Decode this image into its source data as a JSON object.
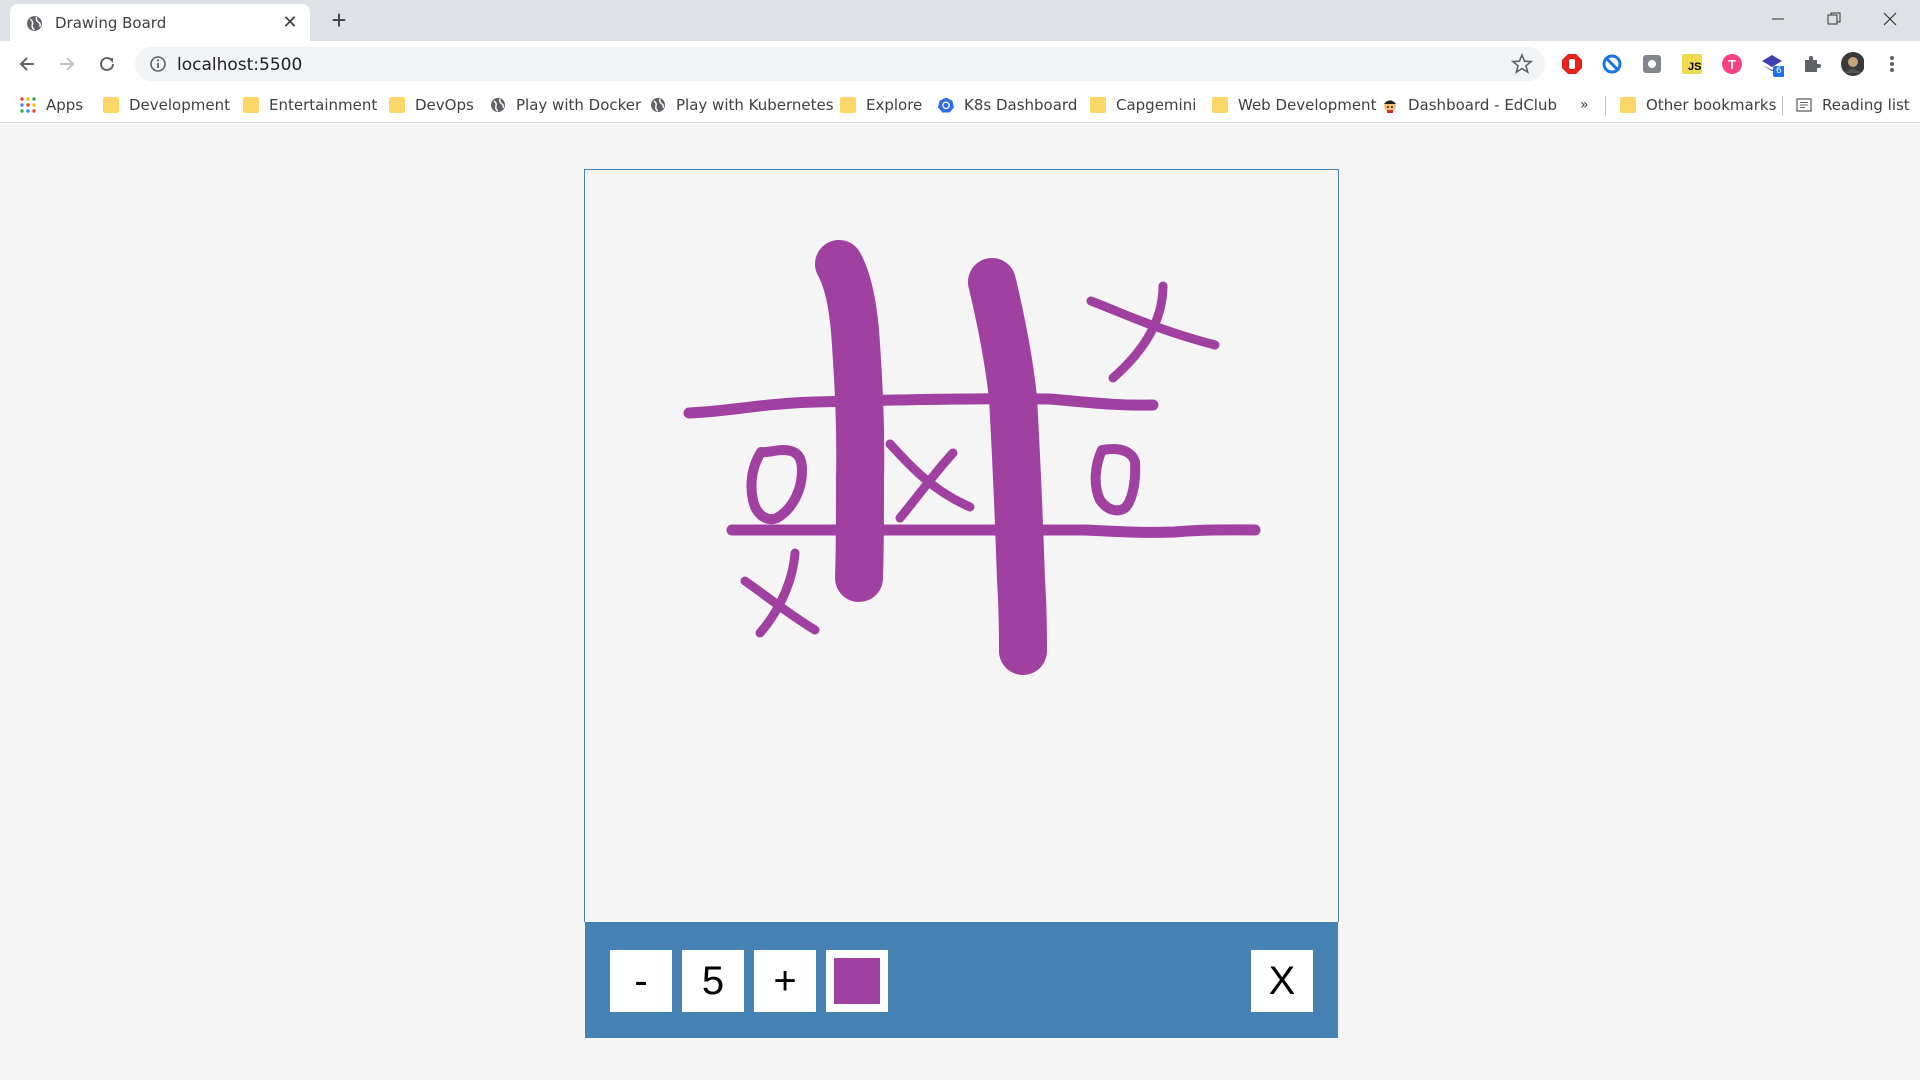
{
  "browser": {
    "tab_title": "Drawing Board",
    "url": "localhost:5500",
    "bookmarks": [
      {
        "label": "Apps",
        "icon": "apps-grid-icon"
      },
      {
        "label": "Development",
        "icon": "folder-icon"
      },
      {
        "label": "Entertainment",
        "icon": "folder-icon"
      },
      {
        "label": "DevOps",
        "icon": "folder-icon"
      },
      {
        "label": "Play with Docker",
        "icon": "globe-icon"
      },
      {
        "label": "Play with Kubernetes",
        "icon": "globe-icon"
      },
      {
        "label": "Explore",
        "icon": "folder-icon"
      },
      {
        "label": "K8s Dashboard",
        "icon": "kubernetes-icon"
      },
      {
        "label": "Capgemini",
        "icon": "folder-icon"
      },
      {
        "label": "Web Development",
        "icon": "folder-icon"
      },
      {
        "label": "Dashboard - EdClub",
        "icon": "edclub-icon"
      }
    ],
    "overflow_label": "»",
    "other_bookmarks": "Other bookmarks",
    "reading_list": "Reading list",
    "extension_badge": "6"
  },
  "app": {
    "decrease_label": "-",
    "size_value": "5",
    "increase_label": "+",
    "color": "#a040a0",
    "clear_label": "X",
    "stroke_color": "#a040a0",
    "toolbox_color": "#4682b4",
    "canvas_background": "#f5f5f5"
  }
}
